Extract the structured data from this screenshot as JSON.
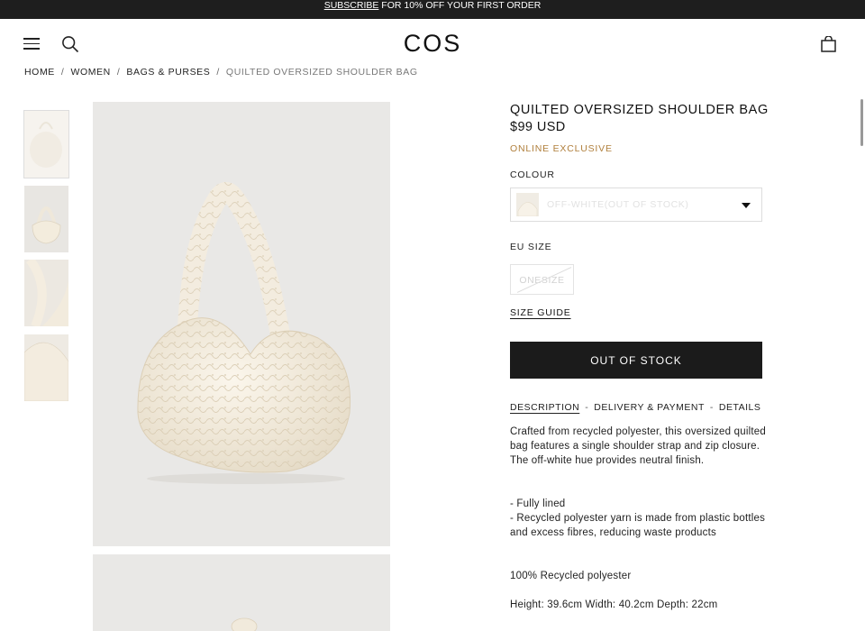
{
  "promo": {
    "link": "SUBSCRIBE",
    "text": " FOR 10% OFF YOUR FIRST ORDER"
  },
  "header": {
    "logo": "COS",
    "icons": [
      "hamburger-menu-icon",
      "search-icon",
      "shopping-bag-icon"
    ]
  },
  "breadcrumb": [
    {
      "label": "HOME"
    },
    {
      "label": "WOMEN"
    },
    {
      "label": "BAGS & PURSES"
    },
    {
      "label": "QUILTED OVERSIZED SHOULDER BAG"
    }
  ],
  "product": {
    "title": "QUILTED OVERSIZED SHOULDER BAG",
    "price": "$99 USD",
    "badge": "ONLINE EXCLUSIVE",
    "colour_label": "COLOUR",
    "colour_value": "OFF-WHITE(OUT OF STOCK)",
    "size_label": "EU SIZE",
    "size_value": "ONESIZE",
    "size_guide": "SIZE GUIDE",
    "cta": "OUT OF STOCK"
  },
  "tabs": [
    {
      "label": "DESCRIPTION",
      "active": true
    },
    {
      "label": "DELIVERY & PAYMENT",
      "active": false
    },
    {
      "label": "DETAILS",
      "active": false
    }
  ],
  "description": {
    "intro": "Crafted from recycled polyester, this oversized quilted bag features a single shoulder strap and zip closure. The off-white hue provides neutral finish.",
    "bullet1": "- Fully lined",
    "bullet2": "- Recycled polyester yarn is made from plastic bottles and excess fibres, reducing waste products",
    "composition": "100% Recycled polyester",
    "dimensions": "Height: 39.6cm Width: 40.2cm Depth: 22cm"
  },
  "colors": {
    "accent": "#b07f3c",
    "dark": "#1b1b1b",
    "promo_bg": "#1e1e1e"
  }
}
